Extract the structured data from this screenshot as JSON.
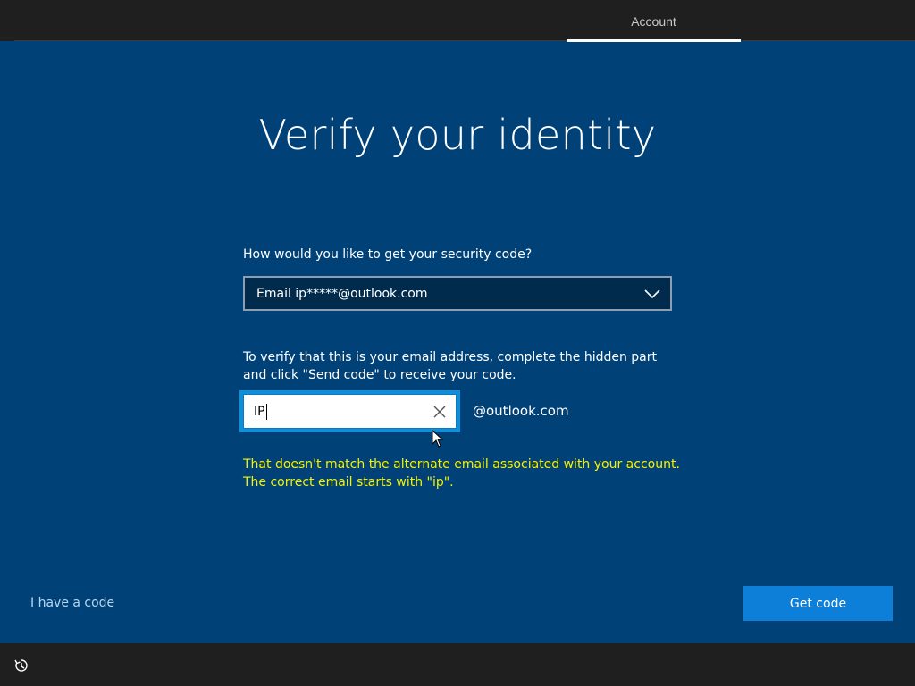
{
  "header": {
    "tab_account": "Account"
  },
  "main": {
    "title": "Verify your identity",
    "question": "How would you like to get your security code?",
    "method_select": {
      "selected": "Email ip*****@outlook.com"
    },
    "instructions": "To verify that this is your email address, complete the hidden part and click \"Send code\" to receive your code.",
    "email_input": {
      "value": "IP"
    },
    "domain_suffix": "@outlook.com",
    "error": {
      "line1": "That doesn't match the alternate email associated with your account.",
      "line2": "The correct email starts with \"ip\"."
    }
  },
  "footer": {
    "have_code": "I have a code",
    "get_code": "Get code"
  },
  "icons": {
    "dropdown": "chevron-down-icon",
    "clear": "close-icon",
    "pointer": "mouse-pointer-icon",
    "accessibility": "ease-of-access-icon"
  },
  "colors": {
    "background": "#004277",
    "accent": "#0d7fd8",
    "error": "#f6f200",
    "link": "#b7d6f2"
  }
}
